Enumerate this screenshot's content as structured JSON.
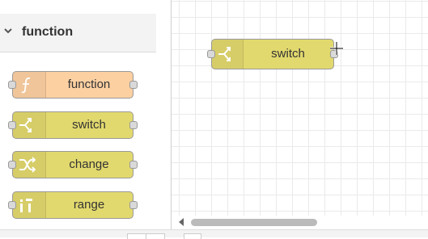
{
  "palette": {
    "category_title": "function",
    "nodes": [
      {
        "label": "function",
        "icon": "function-icon",
        "color": "#fdd0a2"
      },
      {
        "label": "switch",
        "icon": "switch-icon",
        "color": "#e2d96e"
      },
      {
        "label": "change",
        "icon": "change-icon",
        "color": "#e2d96e"
      },
      {
        "label": "range",
        "icon": "range-icon",
        "color": "#e2d96e"
      }
    ]
  },
  "workspace": {
    "node": {
      "label": "switch",
      "icon": "switch-icon",
      "color": "#e2d96e"
    }
  },
  "colors": {
    "function_node": "#fdd0a2",
    "yellow_node": "#e2d96e",
    "port_fill": "#d9d9d9",
    "grid_line": "#eaeaea"
  }
}
